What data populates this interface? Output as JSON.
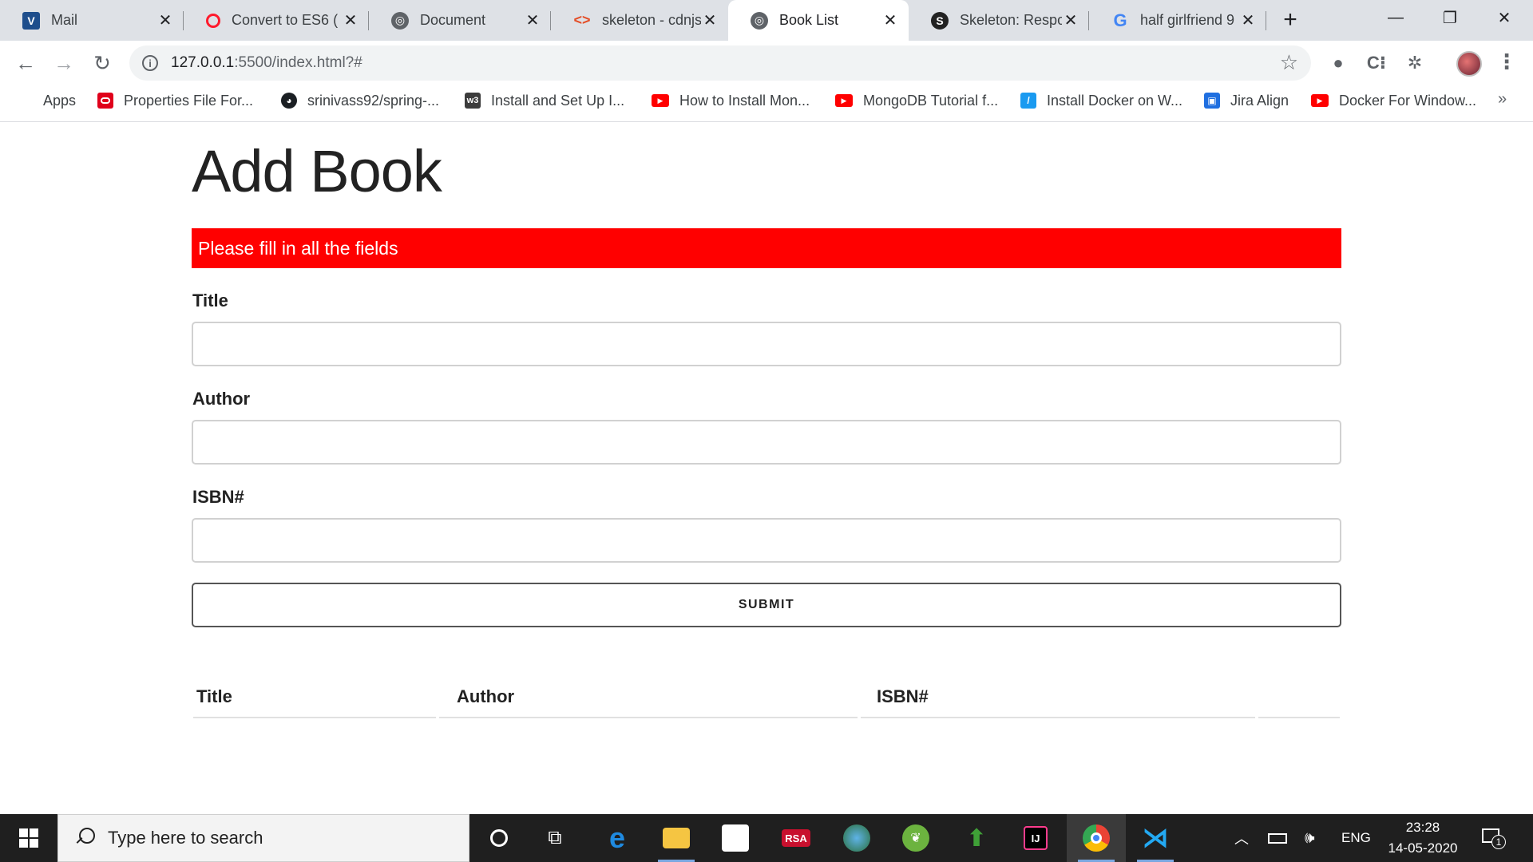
{
  "browser": {
    "tabs": [
      {
        "label": "Mail",
        "icon": "mail-icon",
        "icon_color": "#1e4e8c"
      },
      {
        "label": "Convert to ES6 (",
        "icon": "opera-icon",
        "icon_color": "#ff1b2d"
      },
      {
        "label": "Document",
        "icon": "globe-icon",
        "icon_color": "#5f6368"
      },
      {
        "label": "skeleton - cdnjs",
        "icon": "code-icon",
        "icon_color": "#e44d26"
      },
      {
        "label": "Book List",
        "icon": "globe-icon",
        "icon_color": "#5f6368"
      },
      {
        "label": "Skeleton: Respo",
        "icon": "s-icon",
        "icon_color": "#222222"
      },
      {
        "label": "half girlfriend 9",
        "icon": "google-icon",
        "icon_color": "#4285f4"
      }
    ],
    "active_tab_index": 4,
    "url_host": "127.0.0.1",
    "url_rest": ":5500/index.html?#",
    "bookmarks": [
      {
        "label": "Apps",
        "icon": "apps-grid-icon"
      },
      {
        "label": "Properties File For...",
        "icon": "oracle-icon"
      },
      {
        "label": "srinivass92/spring-...",
        "icon": "github-icon"
      },
      {
        "label": "Install and Set Up I...",
        "icon": "w3-icon"
      },
      {
        "label": "How to Install Mon...",
        "icon": "youtube-icon"
      },
      {
        "label": "MongoDB Tutorial f...",
        "icon": "youtube-icon"
      },
      {
        "label": "Install Docker on W...",
        "icon": "slash-icon"
      },
      {
        "label": "Jira Align",
        "icon": "jira-align-icon"
      },
      {
        "label": "Docker For Window...",
        "icon": "youtube-icon"
      }
    ],
    "bookmarks_more": "»"
  },
  "page": {
    "heading": "Add Book",
    "alert_message": "Please fill in all the fields",
    "alert_color": "#ff0000",
    "fields": {
      "title_label": "Title",
      "title_value": "",
      "author_label": "Author",
      "author_value": "",
      "isbn_label": "ISBN#",
      "isbn_value": ""
    },
    "submit_label": "SUBMIT",
    "table_headers": [
      "Title",
      "Author",
      "ISBN#",
      ""
    ]
  },
  "taskbar": {
    "search_placeholder": "Type here to search",
    "language": "ENG",
    "time": "23:28",
    "date": "14-05-2020",
    "notification_count": "1"
  }
}
